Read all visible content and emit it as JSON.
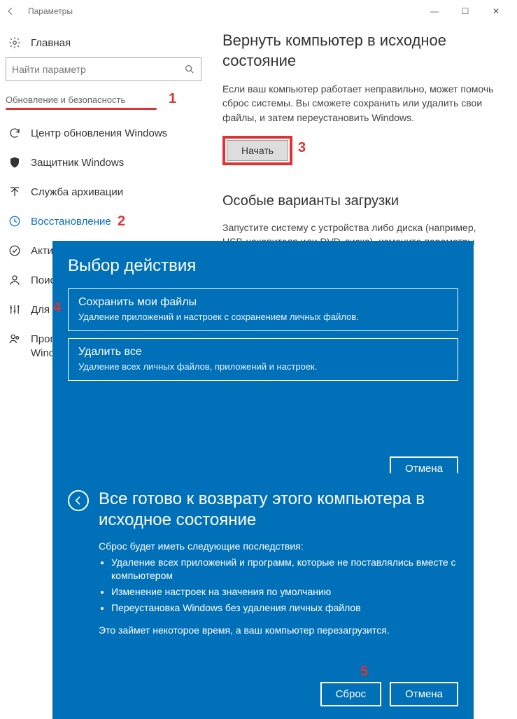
{
  "window": {
    "title": "Параметры",
    "controls": {
      "min": "—",
      "max": "☐",
      "close": "✕"
    }
  },
  "sidebar": {
    "home": "Главная",
    "search_placeholder": "Найти параметр",
    "category": "Обновление и безопасность",
    "items": [
      {
        "label": "Центр обновления Windows",
        "icon": "sync"
      },
      {
        "label": "Защитник Windows",
        "icon": "shield"
      },
      {
        "label": "Служба архивации",
        "icon": "arrow-up"
      },
      {
        "label": "Восстановление",
        "icon": "history",
        "active": true
      },
      {
        "label": "Акти",
        "icon": "check-circle"
      },
      {
        "label": "Поис",
        "icon": "person"
      },
      {
        "label": "Для р",
        "icon": "sliders"
      },
      {
        "label": "Прог\nWind",
        "icon": "people"
      }
    ]
  },
  "content": {
    "reset_title": "Вернуть компьютер в исходное состояние",
    "reset_desc": "Если ваш компьютер работает неправильно, может помочь сброс системы. Вы сможете сохранить или удалить свои файлы, и затем переустановить Windows.",
    "start_btn": "Начать",
    "adv_title": "Особые варианты загрузки",
    "adv_desc": "Запустите систему с устройства либо диска (например, USB-накопителя или DVD-диска), измените параметры загрузки Windows или восстановите ее из образа. Ваш компьютер"
  },
  "dialog1": {
    "title": "Выбор действия",
    "opt1_title": "Сохранить мои файлы",
    "opt1_desc": "Удаление приложений и настроек с сохранением личных файлов.",
    "opt2_title": "Удалить все",
    "opt2_desc": "Удаление всех личных файлов, приложений и настроек.",
    "cancel": "Отмена"
  },
  "dialog2": {
    "title": "Все готово к возврату этого компьютера в исходное состояние",
    "intro": "Сброс будет иметь следующие последствия:",
    "bul1": "Удаление всех приложений и программ, которые не поставлялись вместе с компьютером",
    "bul2": "Изменение настроек на значения по умолчанию",
    "bul3": "Переустановка Windows без удаления личных файлов",
    "note": "Это займет некоторое время, а ваш компьютер перезагрузится.",
    "reset": "Сброс",
    "cancel": "Отмена"
  },
  "annotations": {
    "a1": "1",
    "a2": "2",
    "a3": "3",
    "a4": "4",
    "a5": "5"
  }
}
